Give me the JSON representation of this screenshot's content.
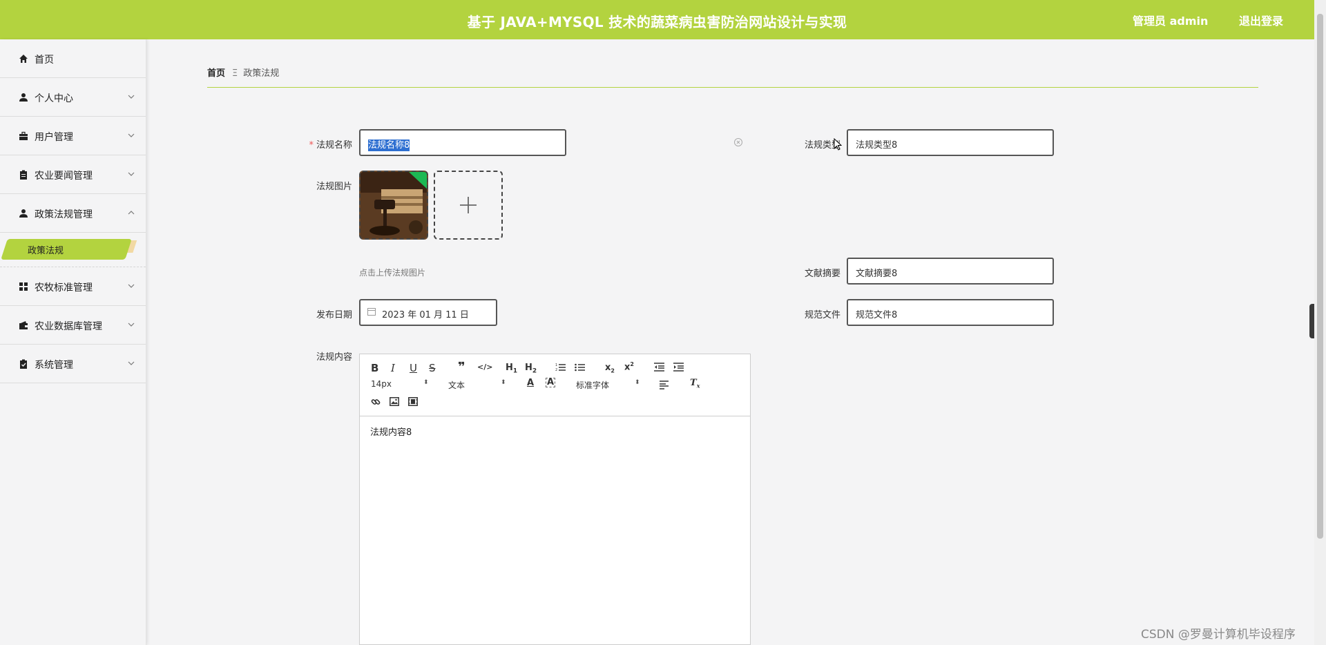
{
  "header": {
    "title": "基于 JAVA+MYSQL 技术的蔬菜病虫害防治网站设计与实现",
    "admin_label": "管理员 admin",
    "logout_label": "退出登录"
  },
  "sidebar": {
    "items": [
      {
        "label": "首页",
        "icon": "home-icon"
      },
      {
        "label": "个人中心",
        "icon": "user-icon"
      },
      {
        "label": "用户管理",
        "icon": "briefcase-icon"
      },
      {
        "label": "农业要闻管理",
        "icon": "clipboard-icon"
      },
      {
        "label": "政策法规管理",
        "icon": "user-icon"
      },
      {
        "label": "农牧标准管理",
        "icon": "grid-icon"
      },
      {
        "label": "农业数据库管理",
        "icon": "wallet-icon"
      },
      {
        "label": "系统管理",
        "icon": "checklist-icon"
      }
    ],
    "active_sub": "政策法规"
  },
  "breadcrumb": {
    "home": "首页",
    "separator": "Ξ",
    "current": "政策法规"
  },
  "form": {
    "name_label": "法规名称",
    "name_value": "法规名称8",
    "type_label": "法规类型",
    "type_value": "法规类型8",
    "image_label": "法规图片",
    "upload_hint": "点击上传法规图片",
    "abstract_label": "文献摘要",
    "abstract_value": "文献摘要8",
    "date_label": "发布日期",
    "date_value": "2023 年 01 月 11 日",
    "file_label": "规范文件",
    "file_value": "规范文件8",
    "content_label": "法规内容",
    "content_value": "法规内容8"
  },
  "editor_toolbar": {
    "font_size": "14px",
    "header_select": "文本",
    "font_family": "标准字体"
  },
  "watermark": "CSDN @罗曼计算机毕设程序",
  "colors": {
    "brand": "#b3d33f",
    "selection": "#2e6fd1"
  }
}
